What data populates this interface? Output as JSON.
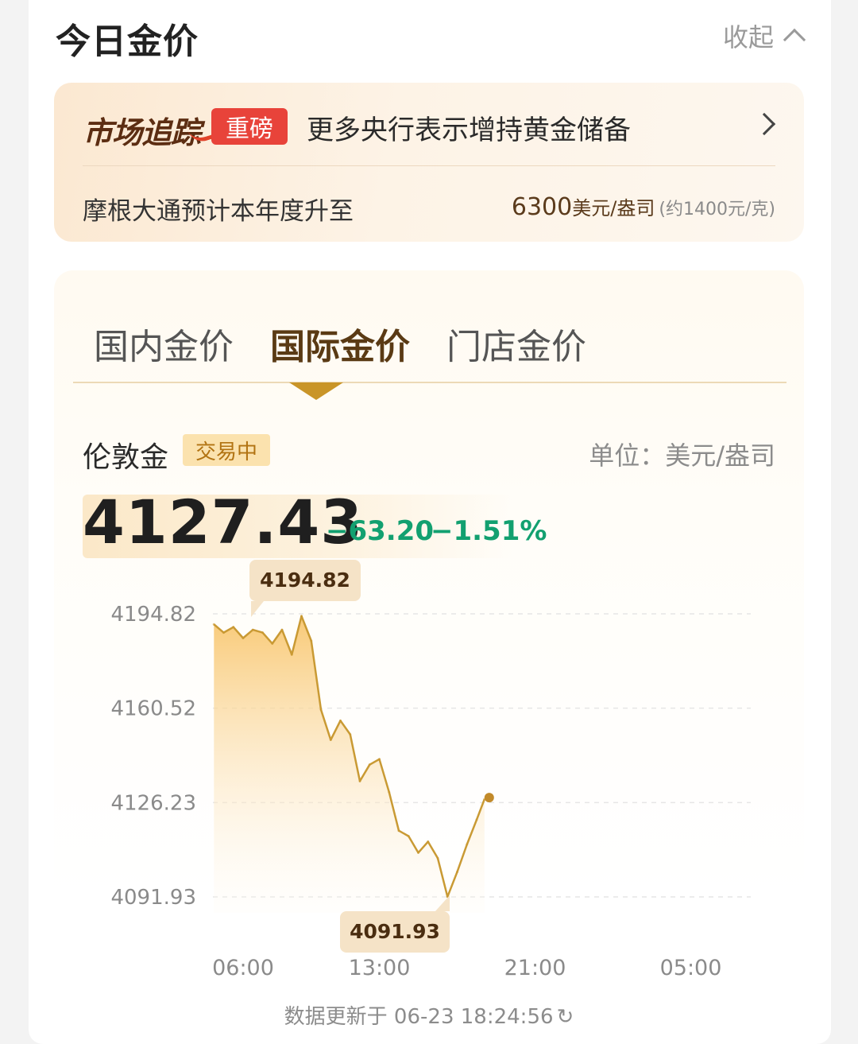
{
  "header": {
    "title": "今日金价",
    "collapse_label": "收起"
  },
  "news": {
    "logo_text": "市场追踪",
    "badge": "重磅",
    "headline": "更多央行表示增持黄金储备",
    "sub_text": "摩根大通预计本年度升至",
    "price_value": "6300",
    "price_unit": "美元/盎司",
    "price_approx": "(约1400元/克)"
  },
  "tabs": [
    {
      "label": "国内金价",
      "active": false
    },
    {
      "label": "国际金价",
      "active": true
    },
    {
      "label": "门店金价",
      "active": false
    }
  ],
  "instrument": {
    "name": "伦敦金",
    "status": "交易中",
    "unit_label": "单位：美元/盎司",
    "price": "4127.43",
    "change": "−63.20",
    "change_pct": "−1.51%"
  },
  "chart_data": {
    "type": "area",
    "y_ticks": [
      "4194.82",
      "4160.52",
      "4126.23",
      "4091.93"
    ],
    "ylim": [
      4091.93,
      4194.82
    ],
    "x_ticks": [
      "06:00",
      "13:00",
      "21:00",
      "05:00"
    ],
    "x_hours": [
      4.5,
      5,
      5.5,
      6,
      6.5,
      7,
      7.5,
      8,
      8.5,
      9,
      9.5,
      10,
      10.5,
      11,
      11.5,
      12,
      12.5,
      13,
      13.5,
      14,
      14.5,
      15,
      15.5,
      16,
      16.5,
      17,
      17.5,
      18,
      18.4
    ],
    "values": [
      4191,
      4188,
      4190,
      4186,
      4189,
      4188,
      4184,
      4189,
      4180,
      4194,
      4185,
      4160,
      4149,
      4156,
      4151,
      4134,
      4140,
      4142,
      4130,
      4116,
      4114,
      4108,
      4112,
      4106,
      4092,
      4101,
      4111,
      4120,
      4127.43
    ],
    "max_label": "4194.82",
    "min_label": "4091.93",
    "colors": {
      "line": "#c99a34",
      "fill_top": "#f8c770",
      "fill_bottom": "#fffaf2",
      "dot": "#c28a2a",
      "callout": "#f5e3c7"
    }
  },
  "footer": {
    "updated": "数据更新于 06-23 18:24:56"
  }
}
